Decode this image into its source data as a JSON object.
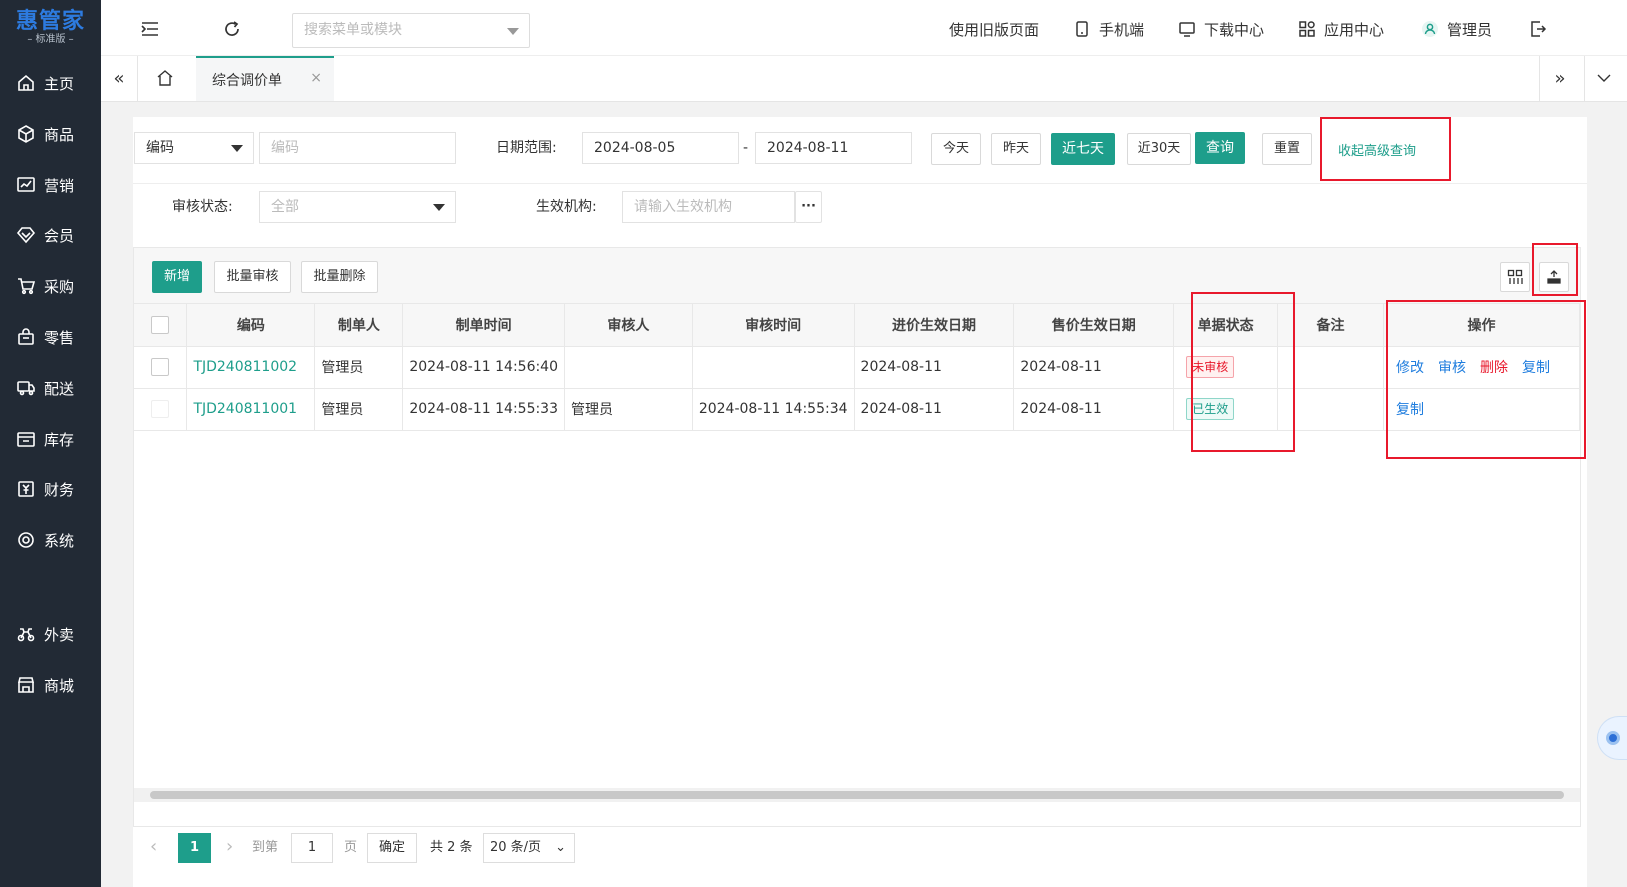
{
  "app": {
    "brand": "惠管家",
    "edition": "– 标准版 –"
  },
  "sidebar": {
    "items": [
      {
        "label": "主页",
        "icon": "home-icon"
      },
      {
        "label": "商品",
        "icon": "box-icon"
      },
      {
        "label": "营销",
        "icon": "chart-icon"
      },
      {
        "label": "会员",
        "icon": "diamond-icon"
      },
      {
        "label": "采购",
        "icon": "cart-icon"
      },
      {
        "label": "零售",
        "icon": "bag-icon"
      },
      {
        "label": "配送",
        "icon": "truck-icon"
      },
      {
        "label": "库存",
        "icon": "warehouse-icon"
      },
      {
        "label": "财务",
        "icon": "finance-icon"
      },
      {
        "label": "系统",
        "icon": "settings-icon"
      },
      {
        "label": "外卖",
        "icon": "delivery-bike-icon"
      },
      {
        "label": "商城",
        "icon": "store-icon"
      }
    ]
  },
  "topbar": {
    "search_placeholder": "搜索菜单或模块",
    "old_page": "使用旧版页面",
    "mobile": "手机端",
    "download": "下载中心",
    "apps": "应用中心",
    "user": "管理员"
  },
  "tabs": {
    "active": "综合调价单"
  },
  "filters": {
    "code_type": "编码",
    "code_placeholder": "编码",
    "date_label": "日期范围:",
    "date_from": "2024-08-05",
    "date_sep": "-",
    "date_to": "2024-08-11",
    "today": "今天",
    "yesterday": "昨天",
    "last7": "近七天",
    "last30": "近30天",
    "query": "查询",
    "reset": "重置",
    "advanced": "收起高级查询",
    "audit_label": "审核状态:",
    "audit_value": "全部",
    "org_label": "生效机构:",
    "org_placeholder": "请输入生效机构",
    "org_more": "···"
  },
  "toolbar": {
    "add": "新增",
    "batch_audit": "批量审核",
    "batch_delete": "批量删除"
  },
  "table": {
    "columns": [
      "编码",
      "制单人",
      "制单时间",
      "审核人",
      "审核时间",
      "进价生效日期",
      "售价生效日期",
      "单据状态",
      "备注",
      "操作"
    ],
    "rows": [
      {
        "code": "TJD240811002",
        "creator": "管理员",
        "created": "2024-08-11 14:56:40",
        "auditor": "",
        "audited": "",
        "cost_date": "2024-08-11",
        "price_date": "2024-08-11",
        "status": "未审核",
        "remark": "",
        "ops": [
          "修改",
          "审核",
          "删除",
          "复制"
        ]
      },
      {
        "code": "TJD240811001",
        "creator": "管理员",
        "created": "2024-08-11 14:55:33",
        "auditor": "管理员",
        "audited": "2024-08-11 14:55:34",
        "cost_date": "2024-08-11",
        "price_date": "2024-08-11",
        "status": "已生效",
        "remark": "",
        "ops": [
          "复制"
        ]
      }
    ]
  },
  "pager": {
    "page": "1",
    "goto_label": "到第",
    "goto_value": "1",
    "page_unit": "页",
    "confirm": "确定",
    "total": "共 2 条",
    "page_size": "20 条/页",
    "prev": "‹",
    "next": "›"
  },
  "colors": {
    "accent": "#1e9e8b",
    "sidebar_bg": "#222a35",
    "danger": "#e8192c",
    "link_blue": "#1f7dde"
  }
}
